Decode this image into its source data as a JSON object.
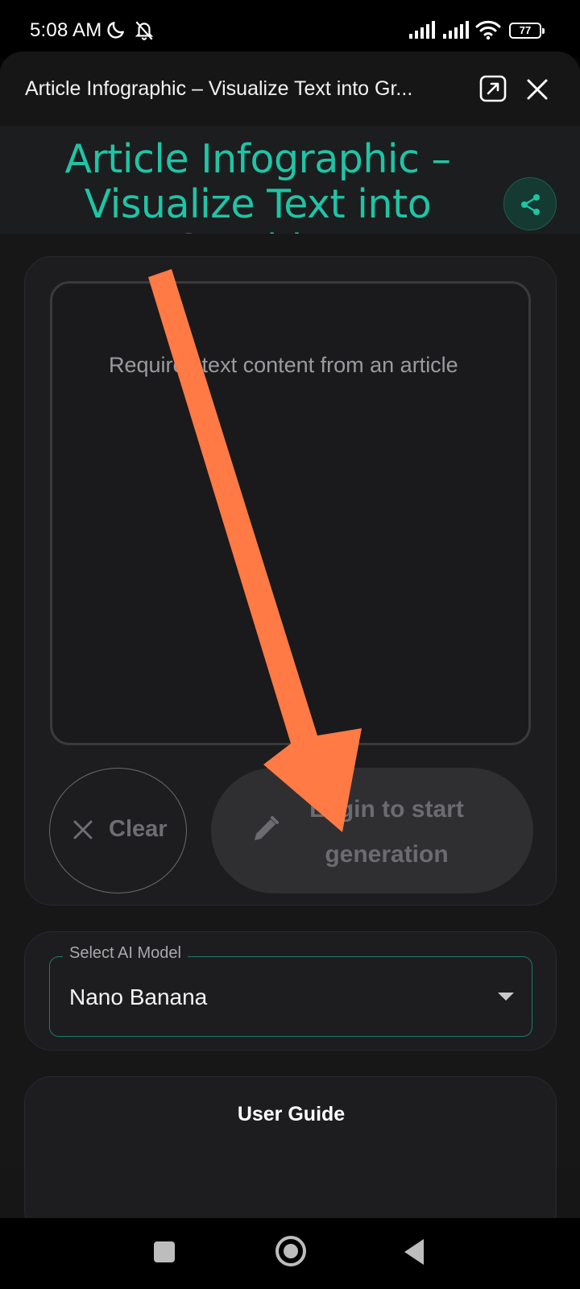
{
  "status_bar": {
    "time": "5:08 AM",
    "battery": "77",
    "icons": [
      "moon-icon",
      "bell-off-icon",
      "signal-icon",
      "signal-icon",
      "wifi-icon",
      "battery-icon"
    ]
  },
  "sheet": {
    "title": "Article Infographic – Visualize Text into Gr..."
  },
  "app": {
    "title": "Article Infographic – Visualize Text into Graphics",
    "accent_color": "#1fc4a6"
  },
  "editor": {
    "placeholder": "Requires text content from an article"
  },
  "actions": {
    "clear_label": "Clear",
    "login_label": "Login to start generation"
  },
  "model": {
    "label": "Select AI Model",
    "value": "Nano Banana"
  },
  "guide": {
    "title": "User Guide"
  },
  "annotation": {
    "color": "#ff7a45"
  }
}
